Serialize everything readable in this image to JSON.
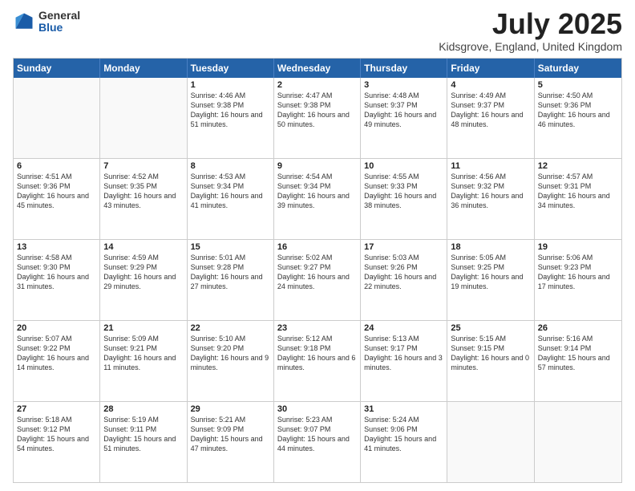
{
  "logo": {
    "general": "General",
    "blue": "Blue"
  },
  "title": "July 2025",
  "location": "Kidsgrove, England, United Kingdom",
  "header_days": [
    "Sunday",
    "Monday",
    "Tuesday",
    "Wednesday",
    "Thursday",
    "Friday",
    "Saturday"
  ],
  "rows": [
    [
      {
        "day": "",
        "sunrise": "",
        "sunset": "",
        "daylight": "",
        "empty": true
      },
      {
        "day": "",
        "sunrise": "",
        "sunset": "",
        "daylight": "",
        "empty": true
      },
      {
        "day": "1",
        "sunrise": "Sunrise: 4:46 AM",
        "sunset": "Sunset: 9:38 PM",
        "daylight": "Daylight: 16 hours and 51 minutes."
      },
      {
        "day": "2",
        "sunrise": "Sunrise: 4:47 AM",
        "sunset": "Sunset: 9:38 PM",
        "daylight": "Daylight: 16 hours and 50 minutes."
      },
      {
        "day": "3",
        "sunrise": "Sunrise: 4:48 AM",
        "sunset": "Sunset: 9:37 PM",
        "daylight": "Daylight: 16 hours and 49 minutes."
      },
      {
        "day": "4",
        "sunrise": "Sunrise: 4:49 AM",
        "sunset": "Sunset: 9:37 PM",
        "daylight": "Daylight: 16 hours and 48 minutes."
      },
      {
        "day": "5",
        "sunrise": "Sunrise: 4:50 AM",
        "sunset": "Sunset: 9:36 PM",
        "daylight": "Daylight: 16 hours and 46 minutes."
      }
    ],
    [
      {
        "day": "6",
        "sunrise": "Sunrise: 4:51 AM",
        "sunset": "Sunset: 9:36 PM",
        "daylight": "Daylight: 16 hours and 45 minutes."
      },
      {
        "day": "7",
        "sunrise": "Sunrise: 4:52 AM",
        "sunset": "Sunset: 9:35 PM",
        "daylight": "Daylight: 16 hours and 43 minutes."
      },
      {
        "day": "8",
        "sunrise": "Sunrise: 4:53 AM",
        "sunset": "Sunset: 9:34 PM",
        "daylight": "Daylight: 16 hours and 41 minutes."
      },
      {
        "day": "9",
        "sunrise": "Sunrise: 4:54 AM",
        "sunset": "Sunset: 9:34 PM",
        "daylight": "Daylight: 16 hours and 39 minutes."
      },
      {
        "day": "10",
        "sunrise": "Sunrise: 4:55 AM",
        "sunset": "Sunset: 9:33 PM",
        "daylight": "Daylight: 16 hours and 38 minutes."
      },
      {
        "day": "11",
        "sunrise": "Sunrise: 4:56 AM",
        "sunset": "Sunset: 9:32 PM",
        "daylight": "Daylight: 16 hours and 36 minutes."
      },
      {
        "day": "12",
        "sunrise": "Sunrise: 4:57 AM",
        "sunset": "Sunset: 9:31 PM",
        "daylight": "Daylight: 16 hours and 34 minutes."
      }
    ],
    [
      {
        "day": "13",
        "sunrise": "Sunrise: 4:58 AM",
        "sunset": "Sunset: 9:30 PM",
        "daylight": "Daylight: 16 hours and 31 minutes."
      },
      {
        "day": "14",
        "sunrise": "Sunrise: 4:59 AM",
        "sunset": "Sunset: 9:29 PM",
        "daylight": "Daylight: 16 hours and 29 minutes."
      },
      {
        "day": "15",
        "sunrise": "Sunrise: 5:01 AM",
        "sunset": "Sunset: 9:28 PM",
        "daylight": "Daylight: 16 hours and 27 minutes."
      },
      {
        "day": "16",
        "sunrise": "Sunrise: 5:02 AM",
        "sunset": "Sunset: 9:27 PM",
        "daylight": "Daylight: 16 hours and 24 minutes."
      },
      {
        "day": "17",
        "sunrise": "Sunrise: 5:03 AM",
        "sunset": "Sunset: 9:26 PM",
        "daylight": "Daylight: 16 hours and 22 minutes."
      },
      {
        "day": "18",
        "sunrise": "Sunrise: 5:05 AM",
        "sunset": "Sunset: 9:25 PM",
        "daylight": "Daylight: 16 hours and 19 minutes."
      },
      {
        "day": "19",
        "sunrise": "Sunrise: 5:06 AM",
        "sunset": "Sunset: 9:23 PM",
        "daylight": "Daylight: 16 hours and 17 minutes."
      }
    ],
    [
      {
        "day": "20",
        "sunrise": "Sunrise: 5:07 AM",
        "sunset": "Sunset: 9:22 PM",
        "daylight": "Daylight: 16 hours and 14 minutes."
      },
      {
        "day": "21",
        "sunrise": "Sunrise: 5:09 AM",
        "sunset": "Sunset: 9:21 PM",
        "daylight": "Daylight: 16 hours and 11 minutes."
      },
      {
        "day": "22",
        "sunrise": "Sunrise: 5:10 AM",
        "sunset": "Sunset: 9:20 PM",
        "daylight": "Daylight: 16 hours and 9 minutes."
      },
      {
        "day": "23",
        "sunrise": "Sunrise: 5:12 AM",
        "sunset": "Sunset: 9:18 PM",
        "daylight": "Daylight: 16 hours and 6 minutes."
      },
      {
        "day": "24",
        "sunrise": "Sunrise: 5:13 AM",
        "sunset": "Sunset: 9:17 PM",
        "daylight": "Daylight: 16 hours and 3 minutes."
      },
      {
        "day": "25",
        "sunrise": "Sunrise: 5:15 AM",
        "sunset": "Sunset: 9:15 PM",
        "daylight": "Daylight: 16 hours and 0 minutes."
      },
      {
        "day": "26",
        "sunrise": "Sunrise: 5:16 AM",
        "sunset": "Sunset: 9:14 PM",
        "daylight": "Daylight: 15 hours and 57 minutes."
      }
    ],
    [
      {
        "day": "27",
        "sunrise": "Sunrise: 5:18 AM",
        "sunset": "Sunset: 9:12 PM",
        "daylight": "Daylight: 15 hours and 54 minutes."
      },
      {
        "day": "28",
        "sunrise": "Sunrise: 5:19 AM",
        "sunset": "Sunset: 9:11 PM",
        "daylight": "Daylight: 15 hours and 51 minutes."
      },
      {
        "day": "29",
        "sunrise": "Sunrise: 5:21 AM",
        "sunset": "Sunset: 9:09 PM",
        "daylight": "Daylight: 15 hours and 47 minutes."
      },
      {
        "day": "30",
        "sunrise": "Sunrise: 5:23 AM",
        "sunset": "Sunset: 9:07 PM",
        "daylight": "Daylight: 15 hours and 44 minutes."
      },
      {
        "day": "31",
        "sunrise": "Sunrise: 5:24 AM",
        "sunset": "Sunset: 9:06 PM",
        "daylight": "Daylight: 15 hours and 41 minutes."
      },
      {
        "day": "",
        "sunrise": "",
        "sunset": "",
        "daylight": "",
        "empty": true
      },
      {
        "day": "",
        "sunrise": "",
        "sunset": "",
        "daylight": "",
        "empty": true
      }
    ]
  ]
}
